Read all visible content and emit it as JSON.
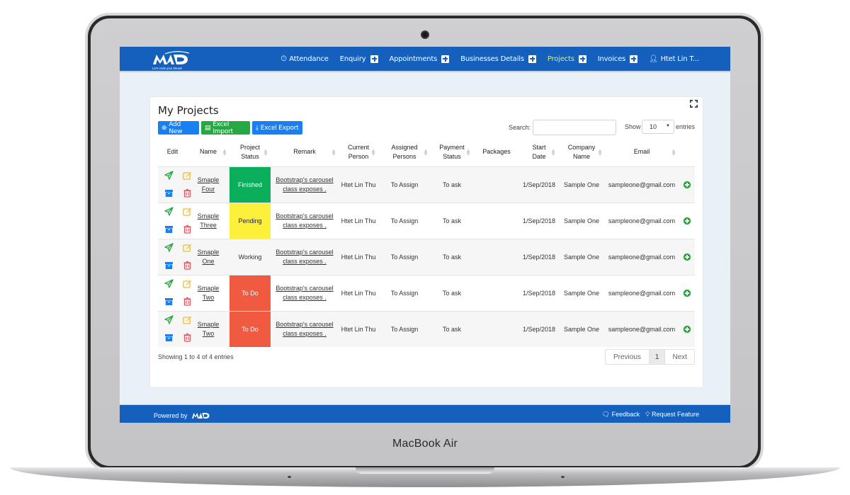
{
  "device": {
    "label": "MacBook Air"
  },
  "header": {
    "logo_text": "MAD",
    "logo_tagline": "Let's code your dream!",
    "nav": [
      {
        "label": "Attendance",
        "icon": "clock-icon",
        "has_plus": false,
        "active": false
      },
      {
        "label": "Enquiry",
        "has_plus": true,
        "active": false
      },
      {
        "label": "Appointments",
        "has_plus": true,
        "active": false
      },
      {
        "label": "Businesses Details",
        "has_plus": true,
        "active": false
      },
      {
        "label": "Projects",
        "has_plus": true,
        "active": true
      },
      {
        "label": "Invoices",
        "has_plus": true,
        "active": false
      },
      {
        "label": "Htet Lin T...",
        "icon": "user-icon",
        "has_plus": false,
        "active": false
      }
    ],
    "active_color": "#e4f25a",
    "bar_color": "#1560bd"
  },
  "card": {
    "title": "My Projects",
    "buttons": {
      "add_new": "Add New",
      "excel_import": "Excel Import",
      "excel_export": "Excel Export"
    },
    "search": {
      "label": "Search:",
      "value": "",
      "placeholder": ""
    },
    "length": {
      "prefix": "Show",
      "value": "10",
      "suffix": "entries"
    }
  },
  "table": {
    "columns": [
      "Edit",
      "Name",
      "Project Status",
      "Remark",
      "Current Person",
      "Assigned Persons",
      "Payment Status",
      "Packages",
      "Start Date",
      "Company Name",
      "Email",
      ""
    ],
    "column_lines": [
      [
        "Edit"
      ],
      [
        "Name"
      ],
      [
        "Project",
        "Status"
      ],
      [
        "Remark"
      ],
      [
        "Current",
        "Person"
      ],
      [
        "Assigned",
        "Persons"
      ],
      [
        "Payment",
        "Status"
      ],
      [
        "Packages"
      ],
      [
        "Start",
        "Date"
      ],
      [
        "Company",
        "Name"
      ],
      [
        "Email"
      ],
      [
        ""
      ]
    ],
    "rows": [
      {
        "name": [
          "Smaple",
          "Four"
        ],
        "status": "Finished",
        "status_color": "#0bae5b",
        "status_text_color": "#ffffff",
        "remark": [
          "Bootstrap's carousel",
          "class exposes ."
        ],
        "current_person": "Htet Lin Thu",
        "assigned": "To Assign",
        "payment": "To ask",
        "packages": "",
        "start_date": "1/Sep/2018",
        "company": "Sample One",
        "email": "sampleone@gmail.com"
      },
      {
        "name": [
          "Smaple",
          "Three"
        ],
        "status": "Pending",
        "status_color": "#fdf03a",
        "status_text_color": "#222222",
        "remark": [
          "Bootstrap's carousel",
          "class exposes ."
        ],
        "current_person": "Htet Lin Thu",
        "assigned": "To Assign",
        "payment": "To ask",
        "packages": "",
        "start_date": "1/Sep/2018",
        "company": "Sample One",
        "email": "sampleone@gmail.com"
      },
      {
        "name": [
          "Smaple",
          "One"
        ],
        "status": "Working",
        "status_color": "",
        "status_text_color": "#333333",
        "remark": [
          "Bootstrap's carousel",
          "class exposes ."
        ],
        "current_person": "Htet Lin Thu",
        "assigned": "To Assign",
        "payment": "To ask",
        "packages": "",
        "start_date": "1/Sep/2018",
        "company": "Sample One",
        "email": "sampleone@gmail.com"
      },
      {
        "name": [
          "Smaple",
          "Two"
        ],
        "status": "To Do",
        "status_color": "#f05a41",
        "status_text_color": "#ffffff",
        "remark": [
          "Bootstrap's carousel",
          "class exposes ."
        ],
        "current_person": "Htet Lin Thu",
        "assigned": "To Assign",
        "payment": "To ask",
        "packages": "",
        "start_date": "1/Sep/2018",
        "company": "Sample One",
        "email": "sampleone@gmail.com"
      },
      {
        "name": [
          "Smaple",
          "Two"
        ],
        "status": "To Do",
        "status_color": "#f05a41",
        "status_text_color": "#ffffff",
        "remark": [
          "Bootstrap's carousel",
          "class exposes ."
        ],
        "current_person": "Htet Lin Thu",
        "assigned": "To Assign",
        "payment": "To ask",
        "packages": "",
        "start_date": "1/Sep/2018",
        "company": "Sample One",
        "email": "sampleone@gmail.com"
      }
    ],
    "info": "Showing 1 to 4 of 4 entries",
    "pagination": {
      "previous": "Previous",
      "current_page": "1",
      "next": "Next"
    }
  },
  "footer": {
    "powered_by": "Powered by",
    "links": [
      {
        "label": "Feedback",
        "icon": "comment-icon"
      },
      {
        "label": "Request Feature",
        "icon": "lightbulb-icon"
      }
    ]
  }
}
